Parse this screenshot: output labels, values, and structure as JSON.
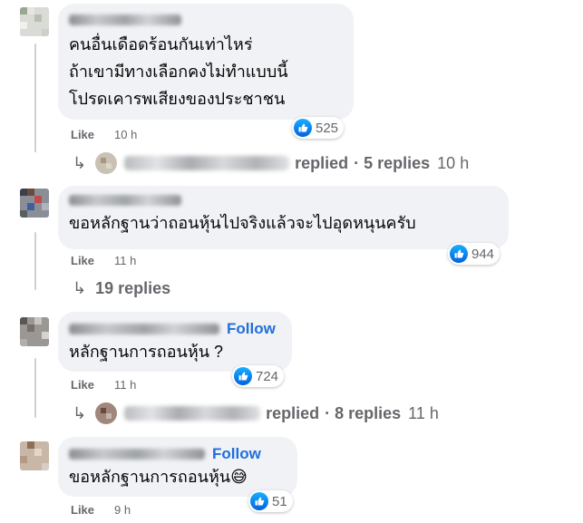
{
  "comments": [
    {
      "lines": [
        "คนอื่นเดือดร้อนกันเท่าไหร่",
        "ถ้าเขามีทางเลือกคงไม่ทำแบบนี้",
        "โปรดเคารพเสียงของประชาชน"
      ],
      "reactions": "525",
      "like_label": "Like",
      "time": "10 h",
      "reply_summary": {
        "verb": "replied",
        "count": "· 5 replies",
        "time": "10 h"
      }
    },
    {
      "lines": [
        "ขอหลักฐานว่าถอนหุ้นไปจริงแล้วจะไปอุดหนุนครับ"
      ],
      "reactions": "944",
      "like_label": "Like",
      "time": "11 h",
      "replies_link": "19 replies"
    },
    {
      "follow": "Follow",
      "lines": [
        "หลักฐานการถอนหุ้น ?"
      ],
      "reactions": "724",
      "like_label": "Like",
      "time": "11 h",
      "reply_summary": {
        "verb": "replied",
        "count": "· 8 replies",
        "time": "11 h"
      }
    },
    {
      "follow": "Follow",
      "lines": [
        "ขอหลักฐานการถอนหุ้น😅"
      ],
      "reactions": "51",
      "like_label": "Like",
      "time": "9 h"
    }
  ],
  "icons": {
    "reply_arrow": "reply-arrow-icon",
    "reaction": "thumbs-up-icon"
  },
  "colors": {
    "bubble": "#f0f2f5",
    "follow": "#216fdb",
    "meta": "#65676b",
    "like_reaction": "#1877f2"
  }
}
